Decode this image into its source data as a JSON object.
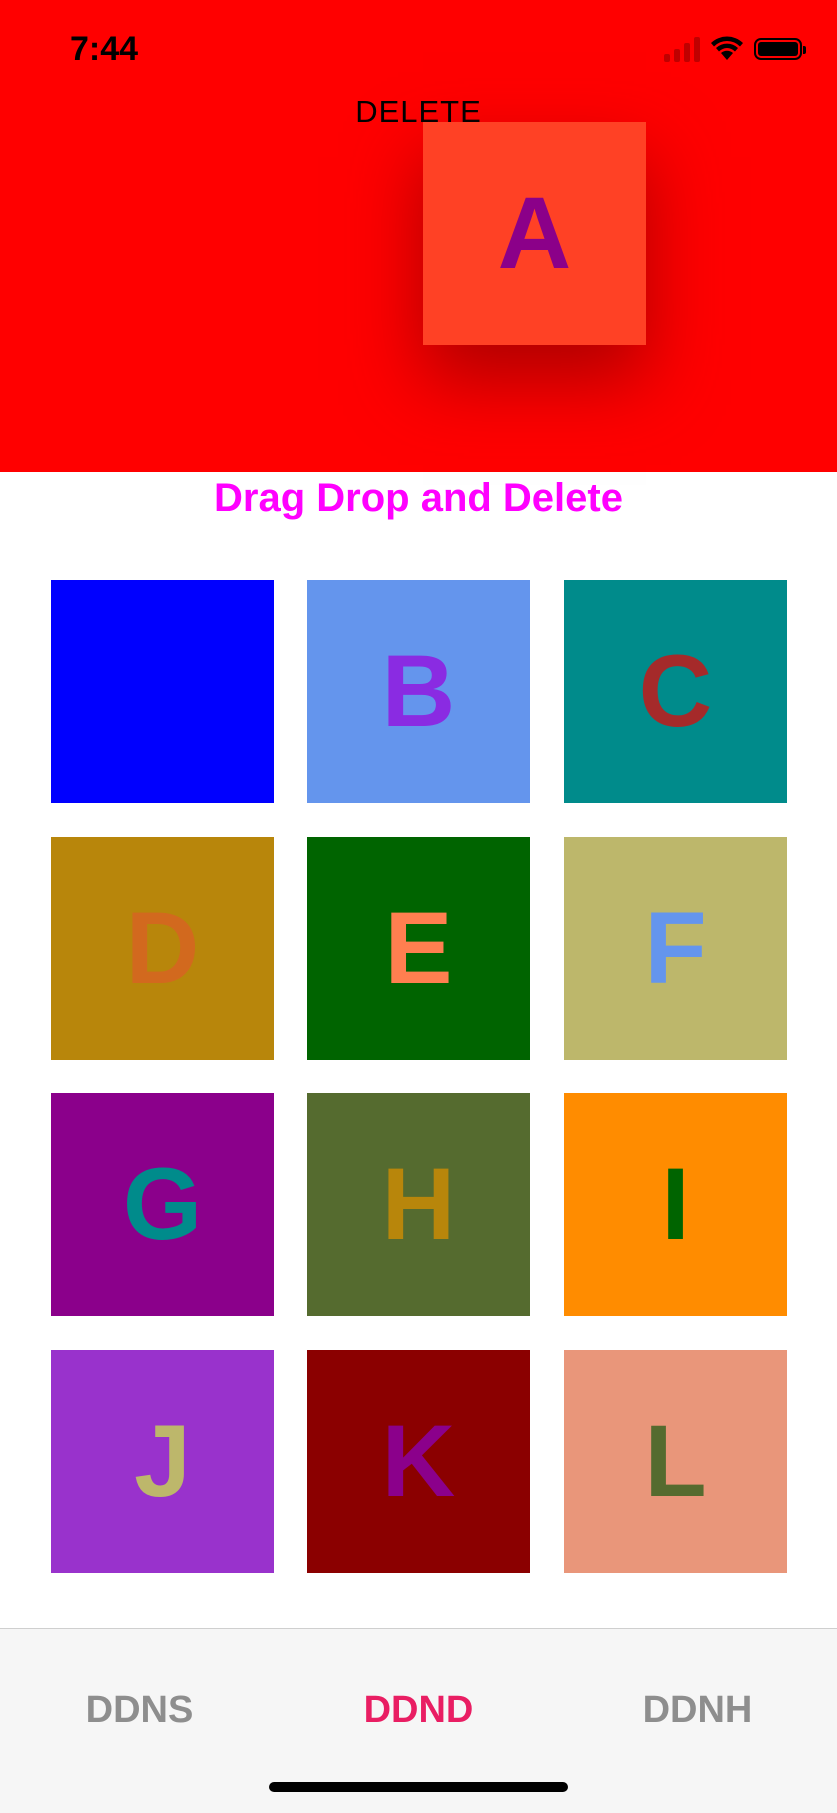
{
  "status_bar": {
    "time": "7:44",
    "icons": [
      "cellular-signal-icon",
      "wifi-icon",
      "battery-icon"
    ]
  },
  "delete_zone": {
    "label": "DELETE",
    "background": "#ff0000",
    "dragged_tile": {
      "letter": "A",
      "bg": "#ff4125",
      "fg": "#8b0089"
    }
  },
  "title": "Drag Drop and Delete",
  "title_color": "#ff00ff",
  "tiles": [
    {
      "letter": "",
      "bg": "#0000ff",
      "fg": "#0000ff"
    },
    {
      "letter": "B",
      "bg": "#6495ed",
      "fg": "#8a2be2"
    },
    {
      "letter": "C",
      "bg": "#008b8b",
      "fg": "#a52a2a"
    },
    {
      "letter": "D",
      "bg": "#b8860b",
      "fg": "#d2691e"
    },
    {
      "letter": "E",
      "bg": "#006400",
      "fg": "#ff7f50"
    },
    {
      "letter": "F",
      "bg": "#bdb76b",
      "fg": "#6495ed"
    },
    {
      "letter": "G",
      "bg": "#8b008b",
      "fg": "#008b8b"
    },
    {
      "letter": "H",
      "bg": "#556b2f",
      "fg": "#b8860b"
    },
    {
      "letter": "I",
      "bg": "#ff8c00",
      "fg": "#006400"
    },
    {
      "letter": "J",
      "bg": "#9932cc",
      "fg": "#bdb76b"
    },
    {
      "letter": "K",
      "bg": "#8b0000",
      "fg": "#8b008b"
    },
    {
      "letter": "L",
      "bg": "#e9967a",
      "fg": "#556b2f"
    }
  ],
  "tabs": [
    {
      "label": "DDNS",
      "color": "#8e8e8e",
      "active": false
    },
    {
      "label": "DDND",
      "color": "#e91e63",
      "active": true
    },
    {
      "label": "DDNH",
      "color": "#8e8e8e",
      "active": false
    }
  ]
}
